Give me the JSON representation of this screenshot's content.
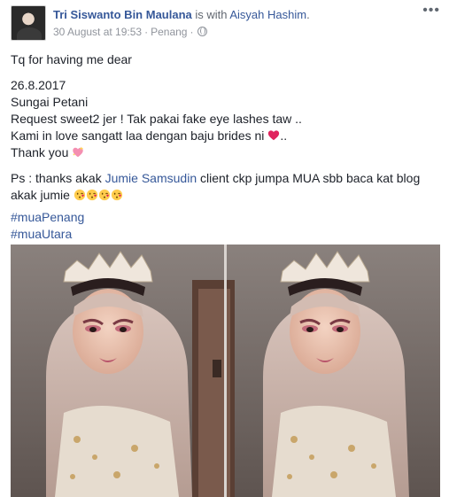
{
  "header": {
    "author": "Tri Siswanto Bin Maulana",
    "with_text": " is with ",
    "tagged": "Aisyah Hashim",
    "period": ".",
    "timestamp": "30 August at 19:53",
    "location": "Penang",
    "more_label": "•••"
  },
  "post": {
    "line_thanks": "Tq for having me dear",
    "date": "26.8.2017",
    "place": "Sungai Petani",
    "request": "Request sweet2 jer ! Tak pakai fake eye lashes taw ..",
    "love_prefix": "Kami in love sangatt laa dengan baju brides ni ",
    "love_suffix": "..",
    "thank_you": "Thank you ",
    "ps_prefix": "Ps : thanks akak ",
    "ps_link": "Jumie Samsudin",
    "ps_suffix": " client ckp jumpa MUA sbb baca kat blog akak jumie ",
    "hashtags": [
      "#muaPenang",
      "#muaUtara"
    ]
  },
  "icons": {
    "globe": "globe-icon",
    "heart": "red-heart-emoji",
    "sparkling_heart": "sparkling-heart-emoji",
    "kiss": "face-blowing-kiss-emoji"
  },
  "colors": {
    "link": "#365899",
    "meta": "#90949c",
    "heart": "#e0245e"
  }
}
